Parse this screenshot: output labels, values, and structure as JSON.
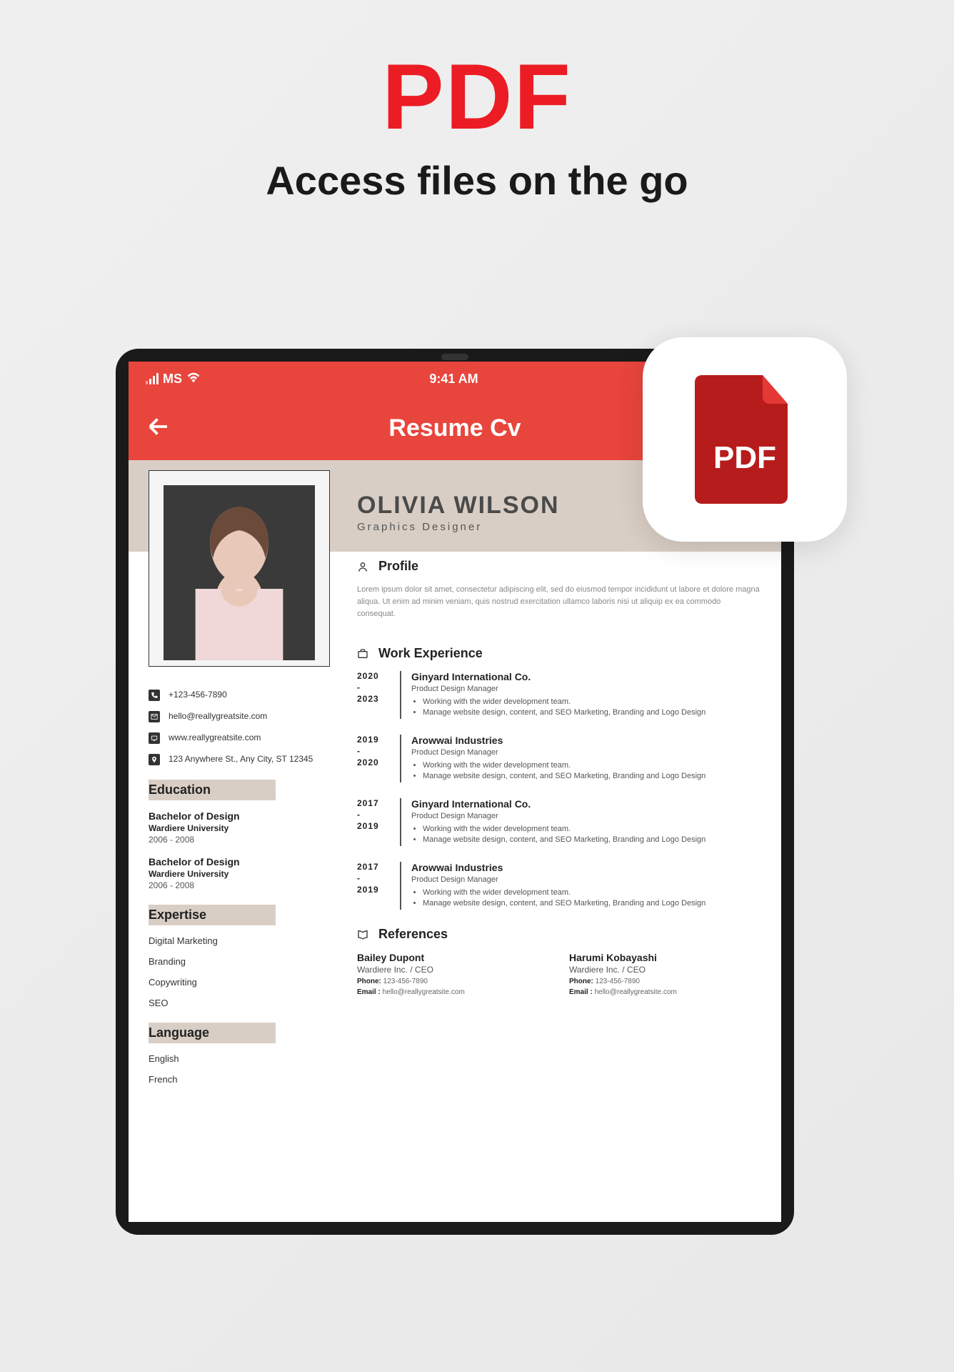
{
  "promo": {
    "pdf": "PDF",
    "subtitle": "Access files on the go",
    "badge_label": "PDF"
  },
  "status": {
    "carrier": "MS",
    "time": "9:41 AM"
  },
  "app": {
    "title": "Resume Cv"
  },
  "resume": {
    "name": "OLIVIA WILSON",
    "role": "Graphics Designer",
    "contact": {
      "phone": "+123-456-7890",
      "email": "hello@reallygreatsite.com",
      "website": "www.reallygreatsite.com",
      "address": "123 Anywhere St., Any City, ST 12345"
    },
    "sections": {
      "education_h": "Education",
      "expertise_h": "Expertise",
      "language_h": "Language",
      "profile_h": "Profile",
      "work_h": "Work Experience",
      "refs_h": "References"
    },
    "education": [
      {
        "degree": "Bachelor of Design",
        "uni": "Wardiere University",
        "years": "2006 - 2008"
      },
      {
        "degree": "Bachelor of Design",
        "uni": "Wardiere University",
        "years": "2006 - 2008"
      }
    ],
    "expertise": [
      "Digital Marketing",
      "Branding",
      "Copywriting",
      "SEO"
    ],
    "languages": [
      "English",
      "French"
    ],
    "profile_text": "Lorem ipsum dolor sit amet, consectetur adipiscing elit, sed do eiusmod tempor incididunt ut labore et dolore magna aliqua. Ut enim ad minim veniam, quis nostrud exercitation ullamco laboris nisi ut aliquip ex ea commodo consequat.",
    "experience": [
      {
        "y1": "2020",
        "y2": "2023",
        "company": "Ginyard International Co.",
        "role": "Product Design Manager",
        "bullets": [
          "Working with the wider development team.",
          "Manage website design, content, and SEO Marketing, Branding and Logo Design"
        ]
      },
      {
        "y1": "2019",
        "y2": "2020",
        "company": "Arowwai Industries",
        "role": "Product Design Manager",
        "bullets": [
          "Working with the wider development team.",
          "Manage website design, content, and SEO Marketing, Branding and Logo Design"
        ]
      },
      {
        "y1": "2017",
        "y2": "2019",
        "company": "Ginyard International Co.",
        "role": "Product Design Manager",
        "bullets": [
          "Working with the wider development team.",
          "Manage website design, content, and SEO Marketing, Branding and Logo Design"
        ]
      },
      {
        "y1": "2017",
        "y2": "2019",
        "company": "Arowwai Industries",
        "role": "Product Design Manager",
        "bullets": [
          "Working with the wider development team.",
          "Manage website design, content, and SEO Marketing, Branding and Logo Design"
        ]
      }
    ],
    "references": [
      {
        "name": "Bailey Dupont",
        "title": "Wardiere Inc. / CEO",
        "phone_l": "Phone:",
        "phone": "123-456-7890",
        "email_l": "Email :",
        "email": "hello@reallygreatsite.com"
      },
      {
        "name": "Harumi Kobayashi",
        "title": "Wardiere Inc. / CEO",
        "phone_l": "Phone:",
        "phone": "123-456-7890",
        "email_l": "Email :",
        "email": "hello@reallygreatsite.com"
      }
    ]
  }
}
